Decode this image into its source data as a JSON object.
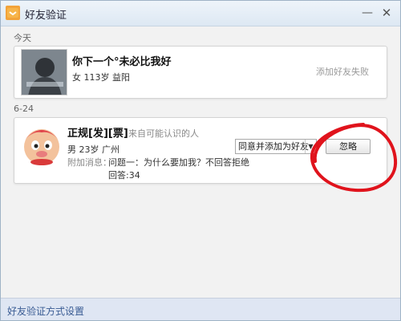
{
  "window": {
    "title": "好友验证",
    "min_glyph": "—",
    "close_glyph": "✕"
  },
  "sections": [
    {
      "label": "今天",
      "card": {
        "nickname": "你下一个°未必比我好",
        "gender_age_city": "女 113岁 益阳",
        "status": "添加好友失败"
      }
    },
    {
      "label": "6-24",
      "card": {
        "nickname": "正规[发][票]",
        "source": "来自可能认识的人",
        "gender_age_city": "男 23岁 广州",
        "attach_label": "附加消息：",
        "question": "问题一：为什么要加我？不回答拒绝",
        "answer": "回答:34",
        "select_value": "同意并添加为好友",
        "ignore_label": "忽略"
      }
    }
  ],
  "footer": {
    "link": "好友验证方式设置"
  },
  "colors": {
    "accent_link": "#3a5c94",
    "annotation": "#e0131c"
  }
}
